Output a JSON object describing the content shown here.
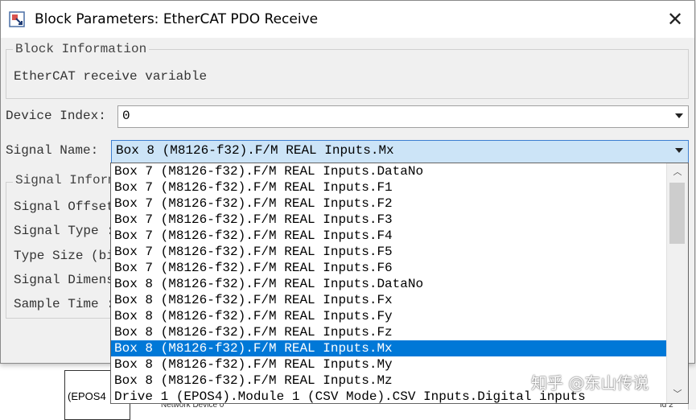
{
  "background": {
    "block_label": "(EPOS4",
    "sub_label_left": "Network Device 0",
    "sub_label_right": "Id 2"
  },
  "dialog": {
    "title": "Block Parameters: EtherCAT PDO Receive",
    "close_glyph": "✕",
    "block_info": {
      "legend": "Block Information",
      "description": "EtherCAT receive variable"
    },
    "device_index": {
      "label": "Device Index:",
      "value": "0"
    },
    "signal_name": {
      "label": "Signal Name:",
      "value": "Box 8 (M8126-f32).F/M REAL Inputs.Mx"
    },
    "signal_info": {
      "legend": "Signal Inform",
      "rows": [
        {
          "label": "Signal Offset"
        },
        {
          "label": "Signal Type :"
        },
        {
          "label": "Type Size (bi"
        },
        {
          "label": "Signal Dimens"
        },
        {
          "label": "Sample Time :"
        }
      ]
    }
  },
  "dropdown": {
    "selected_index": 11,
    "items": [
      "Box 7 (M8126-f32).F/M REAL Inputs.DataNo",
      "Box 7 (M8126-f32).F/M REAL Inputs.F1",
      "Box 7 (M8126-f32).F/M REAL Inputs.F2",
      "Box 7 (M8126-f32).F/M REAL Inputs.F3",
      "Box 7 (M8126-f32).F/M REAL Inputs.F4",
      "Box 7 (M8126-f32).F/M REAL Inputs.F5",
      "Box 7 (M8126-f32).F/M REAL Inputs.F6",
      "Box 8 (M8126-f32).F/M REAL Inputs.DataNo",
      "Box 8 (M8126-f32).F/M REAL Inputs.Fx",
      "Box 8 (M8126-f32).F/M REAL Inputs.Fy",
      "Box 8 (M8126-f32).F/M REAL Inputs.Fz",
      "Box 8 (M8126-f32).F/M REAL Inputs.Mx",
      "Box 8 (M8126-f32).F/M REAL Inputs.My",
      "Box 8 (M8126-f32).F/M REAL Inputs.Mz",
      "Drive 1 (EPOS4).Module 1 (CSV Mode).CSV Inputs.Digital inputs"
    ],
    "scroll_up_glyph": "︿",
    "scroll_down_glyph": "﹀"
  },
  "watermark": "知乎 @东山传说",
  "colors": {
    "selection": "#0078d7",
    "combo_focus": "#cce4f7"
  }
}
